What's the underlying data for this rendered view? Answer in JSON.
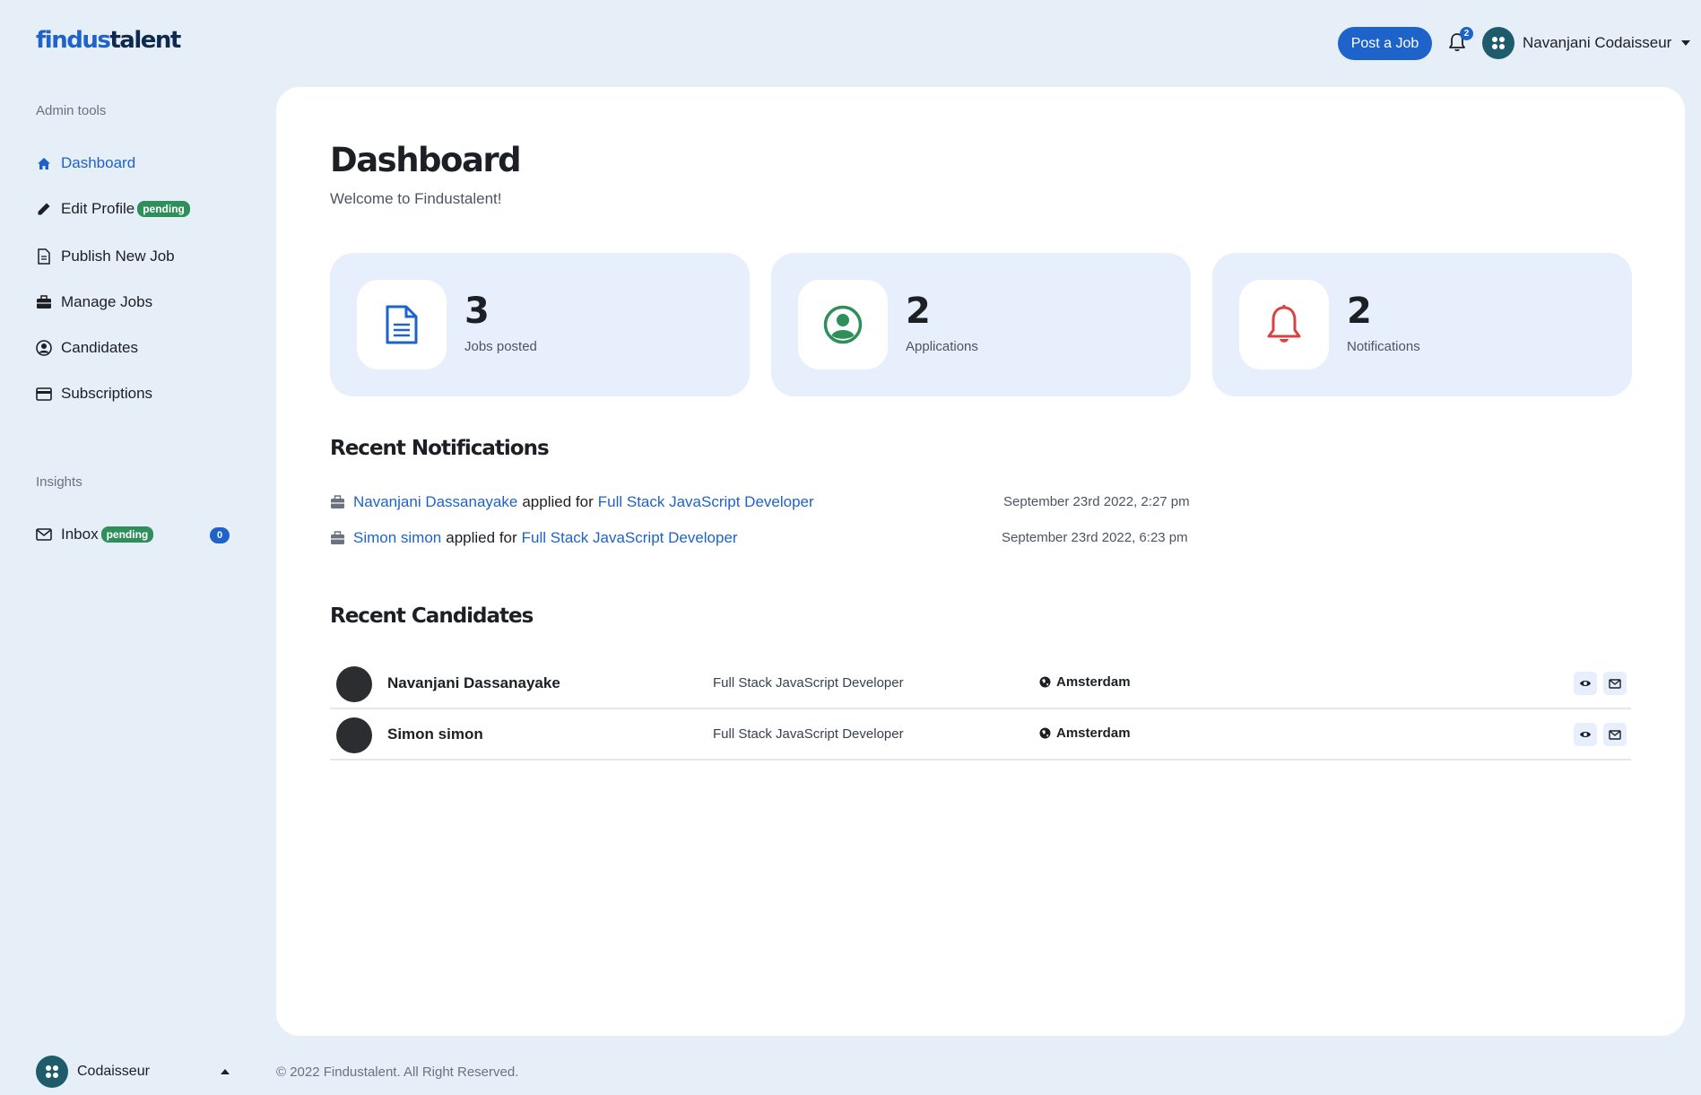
{
  "header": {
    "logo_part1": "findus",
    "logo_part2": "talent",
    "post_job_label": "Post a Job",
    "notification_count": "2",
    "user_name": "Navanjani Codaisseur"
  },
  "sidebar": {
    "section_admin": "Admin tools",
    "items": [
      {
        "label": "Dashboard",
        "icon": "home-icon"
      },
      {
        "label": "Edit Profile",
        "icon": "pencil-icon",
        "badge": "pending"
      },
      {
        "label": "Publish New Job",
        "icon": "document-icon"
      },
      {
        "label": "Manage Jobs",
        "icon": "briefcase-icon"
      },
      {
        "label": "Candidates",
        "icon": "user-circle-icon"
      },
      {
        "label": "Subscriptions",
        "icon": "credit-card-icon"
      }
    ],
    "section_insights": "Insights",
    "inbox": {
      "label": "Inbox",
      "badge": "pending",
      "count": "0",
      "icon": "envelope-icon"
    },
    "org_name": "Codaisseur"
  },
  "main": {
    "title": "Dashboard",
    "subtitle": "Welcome to Findustalent!",
    "stats": [
      {
        "value": "3",
        "label": "Jobs posted",
        "icon": "document-icon",
        "color": "#1e63c9"
      },
      {
        "value": "2",
        "label": "Applications",
        "icon": "user-circle-icon",
        "color": "#2f8f5b"
      },
      {
        "value": "2",
        "label": "Notifications",
        "icon": "bell-icon",
        "color": "#d94343"
      }
    ],
    "recent_notifications_title": "Recent Notifications",
    "notifications": [
      {
        "name": "Navanjani Dassanayake",
        "text": "applied for",
        "job": "Full Stack JavaScript Developer",
        "time": "September 23rd 2022, 2:27 pm"
      },
      {
        "name": "Simon simon",
        "text": "applied for",
        "job": "Full Stack JavaScript Developer",
        "time": "September 23rd 2022, 6:23 pm"
      }
    ],
    "recent_candidates_title": "Recent Candidates",
    "candidates": [
      {
        "name": "Navanjani Dassanayake",
        "job": "Full Stack JavaScript Developer",
        "location": "Amsterdam"
      },
      {
        "name": "Simon simon",
        "job": "Full Stack JavaScript Developer",
        "location": "Amsterdam"
      }
    ]
  },
  "footer": {
    "copyright": "© 2022 Findustalent. All Right Reserved."
  },
  "colors": {
    "accent": "#1e63c9",
    "pending": "#2f8f5b",
    "background": "#e6eef8",
    "card": "#e7eefc"
  }
}
